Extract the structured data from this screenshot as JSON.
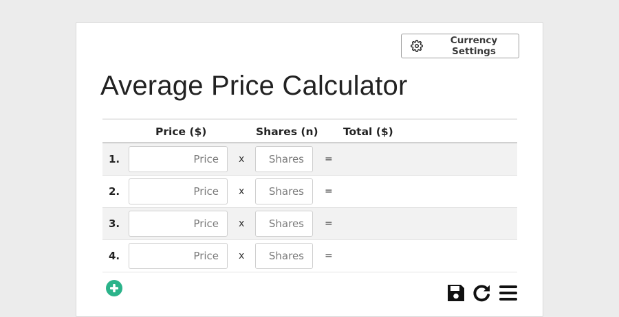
{
  "header": {
    "settings_button_label": "Currency Settings",
    "settings_icon": "gear-icon",
    "title": "Average Price Calculator"
  },
  "table": {
    "columns": {
      "price": "Price ($)",
      "shares": "Shares (n)",
      "total": "Total ($)"
    },
    "operators": {
      "multiply": "x",
      "equals": "="
    },
    "rows": [
      {
        "num": "1.",
        "price_value": "",
        "price_placeholder": "Price",
        "shares_value": "",
        "shares_placeholder": "Shares",
        "total": ""
      },
      {
        "num": "2.",
        "price_value": "",
        "price_placeholder": "Price",
        "shares_value": "",
        "shares_placeholder": "Shares",
        "total": ""
      },
      {
        "num": "3.",
        "price_value": "",
        "price_placeholder": "Price",
        "shares_value": "",
        "shares_placeholder": "Shares",
        "total": ""
      },
      {
        "num": "4.",
        "price_value": "",
        "price_placeholder": "Price",
        "shares_value": "",
        "shares_placeholder": "Shares",
        "total": ""
      }
    ]
  },
  "actions": {
    "add_row_icon": "plus-circle-icon",
    "save_icon": "floppy-disk-icon",
    "reset_icon": "refresh-icon",
    "menu_icon": "hamburger-menu-icon"
  },
  "colors": {
    "accent_green": "#2bb38a",
    "page_background": "#ececec",
    "striped_row": "#f2f2f2"
  }
}
